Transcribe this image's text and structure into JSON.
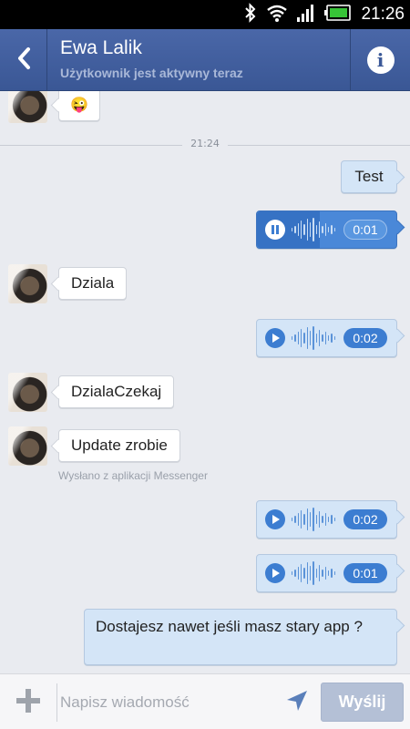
{
  "status_bar": {
    "time": "21:26",
    "icons": [
      "bluetooth-icon",
      "wifi-icon",
      "signal-icon",
      "battery-icon"
    ]
  },
  "header": {
    "contact_name": "Ewa Lalik",
    "status": "Użytkownik jest aktywny teraz",
    "back_icon": "chevron-left-icon",
    "info_icon": "info-icon",
    "info_glyph": "i"
  },
  "chat": {
    "emoji_reply": "😜",
    "time_separator": "21:24",
    "messages": [
      {
        "dir": "out",
        "type": "text",
        "text": "Test"
      },
      {
        "dir": "out",
        "type": "audio",
        "duration": "0:01",
        "state": "playing",
        "progress": 0.45
      },
      {
        "dir": "in",
        "type": "text",
        "text": "Dziala"
      },
      {
        "dir": "out",
        "type": "audio",
        "duration": "0:02",
        "state": "paused"
      },
      {
        "dir": "in",
        "type": "text",
        "text": "DzialaCzekaj"
      },
      {
        "dir": "in",
        "type": "text",
        "text": "Update zrobie"
      },
      {
        "dir": "out",
        "type": "audio",
        "duration": "0:02",
        "state": "paused"
      },
      {
        "dir": "out",
        "type": "audio",
        "duration": "0:01",
        "state": "paused"
      },
      {
        "dir": "out",
        "type": "text",
        "text": "Dostajesz nawet jeśli masz stary app ?"
      }
    ],
    "sent_via": "Wysłano z aplikacji Messenger"
  },
  "composer": {
    "placeholder": "Napisz wiadomość",
    "send_label": "Wyślij",
    "add_icon": "plus-icon",
    "location_icon": "location-arrow-icon"
  },
  "colors": {
    "header_bg": "#3b5998",
    "outgoing_bubble": "#d4e5f7",
    "audio_accent": "#3c7dd1",
    "send_button": "#b4c0d6"
  }
}
